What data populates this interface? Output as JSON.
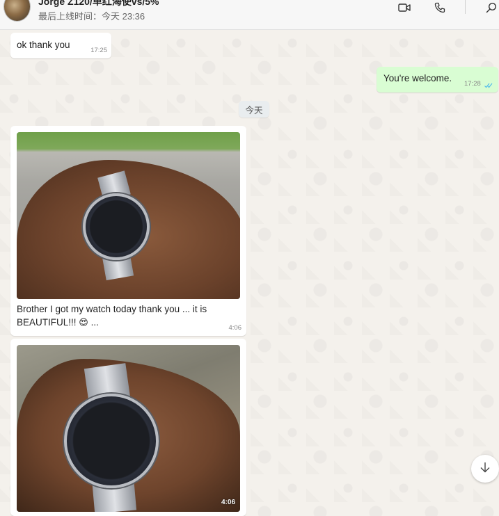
{
  "header": {
    "contact_name": "Jorge Z120/单红海使vs/5%",
    "last_seen": "最后上线时间：今天 23:36",
    "icons": [
      "video-call-icon",
      "voice-call-icon",
      "search-icon"
    ]
  },
  "messages": [
    {
      "direction": "incoming",
      "text": "ok thank you",
      "time": "17:25"
    },
    {
      "direction": "outgoing",
      "text": "You're welcome.",
      "time": "17:28",
      "status": "read"
    },
    {
      "type": "date",
      "text": "今天"
    },
    {
      "direction": "incoming",
      "type": "image",
      "caption": "Brother I got my watch today thank you ... it is BEAUTIFUL!!!",
      "caption_tail": "...",
      "emoji": "😍",
      "time": "4:06"
    },
    {
      "direction": "incoming",
      "type": "video",
      "time": "4:06"
    }
  ],
  "colors": {
    "outgoing_bubble": "#d9fdd3",
    "incoming_bubble": "#ffffff",
    "read_ticks": "#53bdeb"
  },
  "scroll_button": {
    "icon": "arrow-down-icon"
  }
}
